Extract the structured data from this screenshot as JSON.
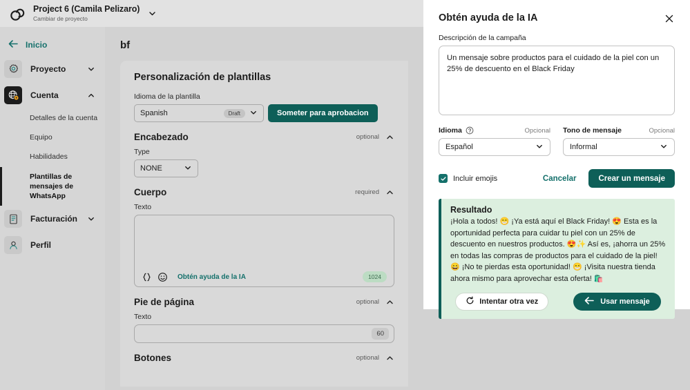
{
  "topbar": {
    "logo_icon": "interlocking-circles-logo",
    "project_name": "Project 6 (Camila Pelizaro)",
    "project_switch": "Cambiar de proyecto",
    "caret_icon": "chevron-down-icon"
  },
  "sidebar": {
    "home_label": "Inicio",
    "home_icon": "arrow-left-icon",
    "items": [
      {
        "label": "Proyecto",
        "icon": "gear-icon",
        "caret": "chevron-down-icon",
        "expanded": false
      },
      {
        "label": "Cuenta",
        "icon": "globe-gear-icon",
        "caret": "chevron-up-icon",
        "expanded": true
      },
      {
        "label": "Facturación",
        "icon": "invoice-icon",
        "caret": "chevron-down-icon",
        "expanded": false
      },
      {
        "label": "Perfil",
        "icon": "person-icon",
        "caret": "",
        "expanded": false
      }
    ],
    "account_subitems": [
      {
        "label": "Detalles de la cuenta",
        "active": false
      },
      {
        "label": "Equipo",
        "active": false
      },
      {
        "label": "Habilidades",
        "active": false
      },
      {
        "label": "Plantillas de mensajes de WhatsApp",
        "active": true
      }
    ]
  },
  "main": {
    "page_title": "bf",
    "card_title": "Personalización de plantillas",
    "language_label": "Idioma de la plantilla",
    "language_value": "Spanish",
    "language_badge": "Draft",
    "submit_label": "Someter para aprobacion",
    "sections": {
      "header": {
        "title": "Encabezado",
        "flag": "optional",
        "type_label": "Type",
        "type_value": "NONE"
      },
      "body": {
        "title": "Cuerpo",
        "flag": "required",
        "text_label": "Texto",
        "value": "",
        "braces_icon": "curly-braces-icon",
        "emoji_icon": "emoji-smiley-icon",
        "ai_link": "Obtén ayuda de la IA",
        "counter": "1024"
      },
      "footer": {
        "title": "Pie de página",
        "flag": "optional",
        "text_label": "Texto",
        "value": "",
        "counter": "60"
      },
      "buttons": {
        "title": "Botones",
        "flag": "optional"
      }
    }
  },
  "panel": {
    "title": "Obtén ayuda de la IA",
    "close_icon": "close-icon",
    "description_label": "Descripción de la campaña",
    "description_value": "Un mensaje sobre productos para el cuidado de la piel con un 25% de descuento en el Black Friday",
    "language": {
      "label": "Idioma",
      "help_icon": "help-circle-icon",
      "optional": "Opcional",
      "value": "Español",
      "caret": "chevron-down-icon"
    },
    "tone": {
      "label": "Tono de mensaje",
      "optional": "Opcional",
      "value": "Informal",
      "caret": "chevron-down-icon"
    },
    "include_emojis_label": "Incluir emojis",
    "include_emojis_checked": true,
    "check_icon": "checkmark-icon",
    "cancel_label": "Cancelar",
    "create_label": "Crear un mensaje",
    "result": {
      "title": "Resultado",
      "text": "¡Hola a todos! 😁 ¡Ya está aquí el Black Friday! 😍 Esta es la oportunidad perfecta para cuidar tu piel con un 25% de descuento en nuestros productos. 😍✨ Así es, ¡ahorra un 25% en todas las compras de productos para el cuidado de la piel! 😄 ¡No te pierdas esta oportunidad! 😁 ¡Visita nuestra tienda ahora mismo para aprovechar esta oferta! 🛍️",
      "retry_label": "Intentar otra vez",
      "retry_icon": "refresh-icon",
      "use_label": "Usar mensaje",
      "use_icon": "arrow-left-icon"
    }
  },
  "colors": {
    "accent_teal": "#0e5f58",
    "link_teal": "#14706b",
    "result_bg": "#dcefdf",
    "sidebar_bg": "#d6d6d6",
    "main_bg": "#d2d2d2",
    "card_bg": "#d9d9d9"
  }
}
